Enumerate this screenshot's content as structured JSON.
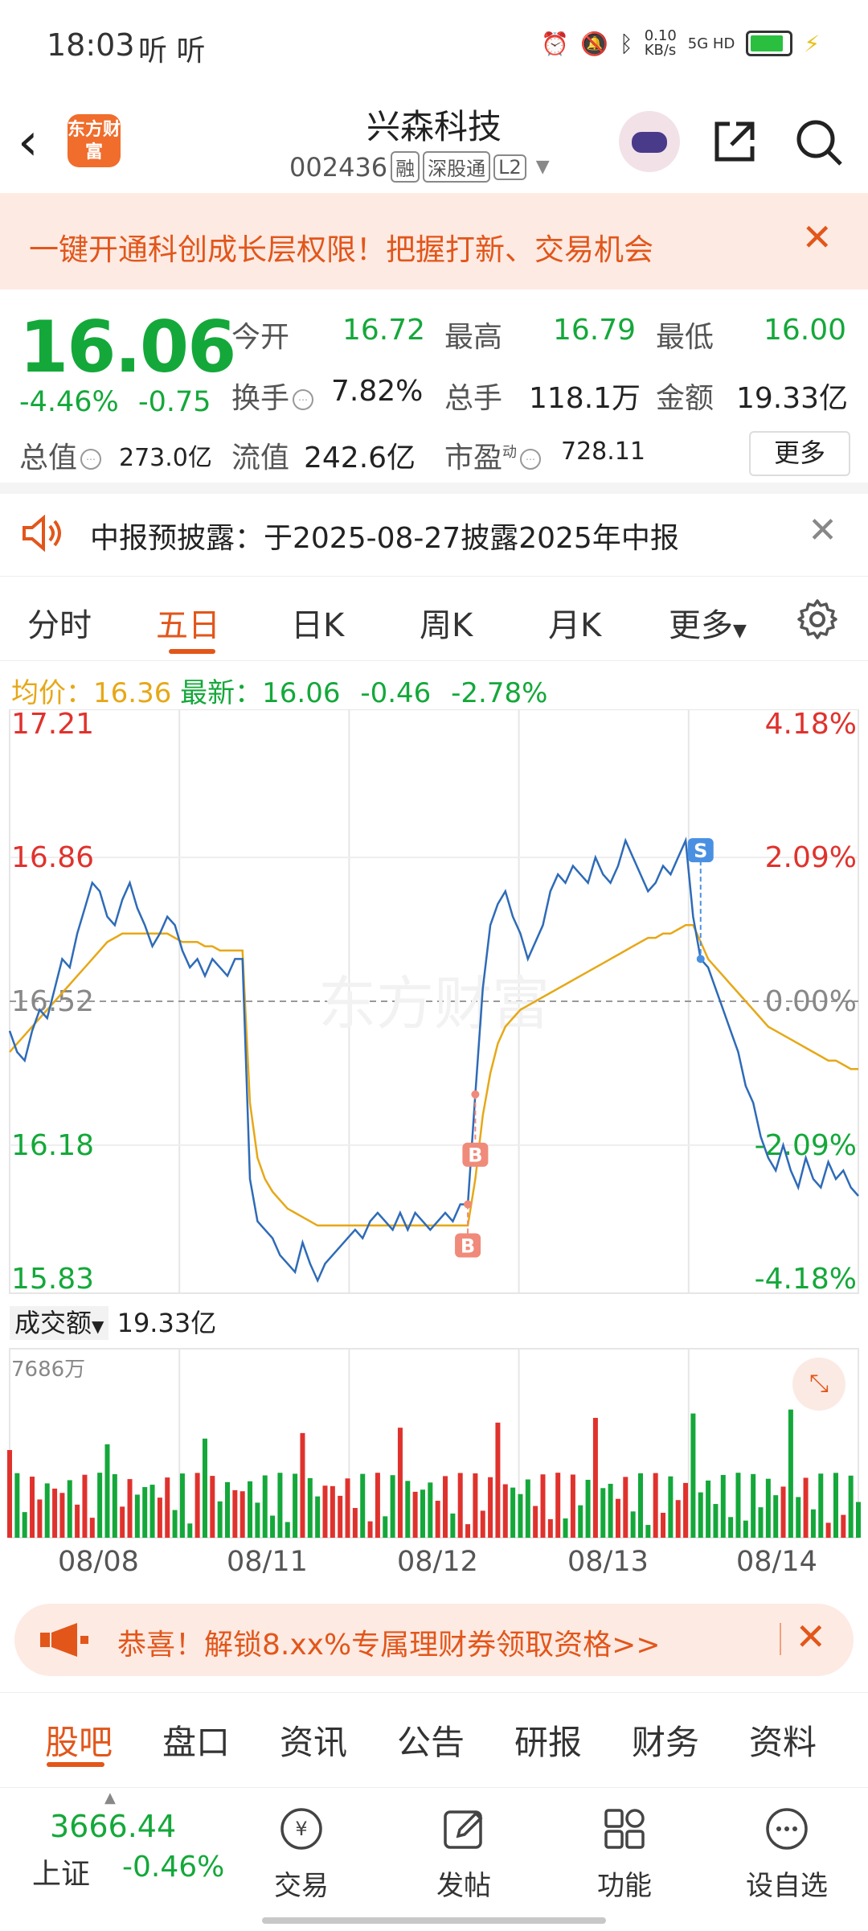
{
  "status_bar": {
    "time": "18:03",
    "listen_labels": "听 听",
    "net_speed": "0.10",
    "net_unit": "KB/s",
    "signal": "5G HD"
  },
  "header": {
    "logo_text": "东方财富",
    "stock_name": "兴森科技",
    "stock_code": "002436",
    "tags": [
      "融",
      "深股通",
      "L2"
    ]
  },
  "promo_banner_top": {
    "text": "一键开通科创成长层权限！把握打新、交易机会"
  },
  "quote": {
    "price": "16.06",
    "change_pct": "-4.46%",
    "change_abs": "-0.75",
    "fields": {
      "open_label": "今开",
      "open": "16.72",
      "high_label": "最高",
      "high": "16.79",
      "low_label": "最低",
      "low": "16.00",
      "turnover_label": "换手",
      "turnover": "7.82%",
      "volume_label": "总手",
      "volume": "118.1万",
      "amount_label": "金额",
      "amount": "19.33亿",
      "mktcap_label": "总值",
      "mktcap": "273.0亿",
      "float_label": "流值",
      "float": "242.6亿",
      "pe_label": "市盈",
      "pe_sup": "动",
      "pe": "728.11"
    },
    "more_button": "更多"
  },
  "notice": {
    "text": "中报预披露：于2025-08-27披露2025年中报"
  },
  "chart_tabs": [
    "分时",
    "五日",
    "日K",
    "周K",
    "月K",
    "更多"
  ],
  "active_chart_tab": 1,
  "avg_line": {
    "avg_label": "均价：",
    "avg_value": "16.36",
    "latest_label": "最新：",
    "latest_value": "16.06",
    "latest_change": "-0.46",
    "latest_pct": "-2.78%"
  },
  "chart_data": {
    "type": "line",
    "title": "",
    "x": [
      "08/08",
      "08/11",
      "08/12",
      "08/13",
      "08/14"
    ],
    "ylim": [
      15.83,
      17.21
    ],
    "y_ticks_left": [
      "17.21",
      "16.86",
      "16.52",
      "16.18",
      "15.83"
    ],
    "y_ticks_right": [
      "4.18%",
      "2.09%",
      "0.00%",
      "-2.09%",
      "-4.18%"
    ],
    "reference_price": 16.52,
    "series": [
      {
        "type": "price",
        "values": [
          16.45,
          16.4,
          16.38,
          16.45,
          16.5,
          16.48,
          16.55,
          16.62,
          16.6,
          16.68,
          16.74,
          16.8,
          16.78,
          16.72,
          16.7,
          16.76,
          16.8,
          16.74,
          16.7,
          16.65,
          16.68,
          16.72,
          16.7,
          16.64,
          16.6,
          16.62,
          16.58,
          16.62,
          16.6,
          16.58,
          16.62,
          16.62,
          16.1,
          16.0,
          15.98,
          15.96,
          15.92,
          15.9,
          15.88,
          15.95,
          15.9,
          15.86,
          15.9,
          15.92,
          15.94,
          15.96,
          15.98,
          15.96,
          16.0,
          16.02,
          16.0,
          15.98,
          16.02,
          15.98,
          16.02,
          16.0,
          15.98,
          16.0,
          16.02,
          16.0,
          16.04,
          16.04,
          16.3,
          16.55,
          16.7,
          16.75,
          16.78,
          16.72,
          16.68,
          16.62,
          16.66,
          16.7,
          16.78,
          16.82,
          16.8,
          16.84,
          16.82,
          16.8,
          16.86,
          16.82,
          16.8,
          16.84,
          16.9,
          16.86,
          16.82,
          16.78,
          16.8,
          16.84,
          16.82,
          16.86,
          16.9,
          16.72,
          16.62,
          16.6,
          16.55,
          16.5,
          16.45,
          16.4,
          16.32,
          16.28,
          16.2,
          16.15,
          16.12,
          16.18,
          16.12,
          16.08,
          16.15,
          16.1,
          16.08,
          16.14,
          16.1,
          16.12,
          16.08,
          16.06
        ]
      },
      {
        "type": "average",
        "values": [
          16.4,
          16.42,
          16.44,
          16.46,
          16.48,
          16.5,
          16.52,
          16.54,
          16.56,
          16.58,
          16.6,
          16.62,
          16.64,
          16.66,
          16.67,
          16.68,
          16.68,
          16.68,
          16.68,
          16.68,
          16.68,
          16.68,
          16.67,
          16.66,
          16.66,
          16.66,
          16.65,
          16.65,
          16.64,
          16.64,
          16.64,
          16.64,
          16.28,
          16.15,
          16.1,
          16.07,
          16.05,
          16.03,
          16.02,
          16.01,
          16.0,
          15.99,
          15.99,
          15.99,
          15.99,
          15.99,
          15.99,
          15.99,
          15.99,
          15.99,
          15.99,
          15.99,
          15.99,
          15.99,
          15.99,
          15.99,
          15.99,
          15.99,
          15.99,
          15.99,
          15.99,
          15.99,
          16.1,
          16.25,
          16.35,
          16.42,
          16.46,
          16.48,
          16.5,
          16.51,
          16.52,
          16.53,
          16.54,
          16.55,
          16.56,
          16.57,
          16.58,
          16.59,
          16.6,
          16.61,
          16.62,
          16.63,
          16.64,
          16.65,
          16.66,
          16.67,
          16.67,
          16.68,
          16.68,
          16.69,
          16.7,
          16.7,
          16.66,
          16.62,
          16.6,
          16.58,
          16.56,
          16.54,
          16.52,
          16.5,
          16.48,
          16.46,
          16.45,
          16.44,
          16.43,
          16.42,
          16.41,
          16.4,
          16.39,
          16.38,
          16.38,
          16.37,
          16.36,
          16.36
        ]
      }
    ],
    "markers": [
      {
        "label": "S",
        "index": 92
      },
      {
        "label": "B",
        "index": 61
      },
      {
        "label": "B",
        "index": 62
      }
    ],
    "volume": {
      "label": "成交额",
      "total": "19.33亿",
      "max_label": "7686万"
    }
  },
  "promo_banner_bottom": {
    "text": "恭喜！解锁8.xx%专属理财券领取资格>>"
  },
  "sub_tabs": [
    "股吧",
    "盘口",
    "资讯",
    "公告",
    "研报",
    "财务",
    "资料"
  ],
  "active_sub_tab": 0,
  "bottom_bar": {
    "index_value": "3666.44",
    "index_name": "上证",
    "index_change": "-0.46%",
    "nav": [
      "交易",
      "发帖",
      "功能",
      "设自选"
    ]
  },
  "colors": {
    "accent": "#e2561a",
    "up": "#e0322d",
    "down": "#14a83a",
    "price_line": "#2e6bb8",
    "avg_line": "#e6a817"
  }
}
